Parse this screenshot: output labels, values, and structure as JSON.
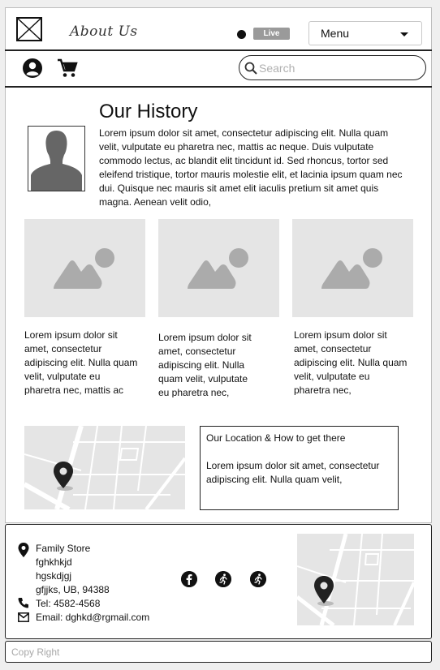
{
  "header": {
    "brand": "About Us",
    "live_label": "Live",
    "menu_label": "Menu"
  },
  "toolbar": {
    "search_placeholder": "Search"
  },
  "history": {
    "title": "Our History",
    "body": "Lorem ipsum dolor sit amet, consectetur adipiscing elit. Nulla quam velit, vulputate eu pharetra nec, mattis ac neque. Duis vulputate commodo lectus, ac blandit elit tincidunt id. Sed rhoncus, tortor sed eleifend tristique, tortor mauris molestie elit, et lacinia ipsum quam nec dui. Quisque nec mauris sit amet elit iaculis pretium sit amet quis magna. Aenean velit odio,"
  },
  "cards": [
    {
      "text": "Lorem ipsum dolor sit amet, consectetur adipiscing elit. Nulla quam velit, vulputate eu pharetra nec, mattis ac"
    },
    {
      "text": "Lorem ipsum dolor sit amet, consectetur adipiscing elit. Nulla quam velit, vulputate eu pharetra nec,"
    },
    {
      "text": "Lorem ipsum dolor sit amet, consectetur adipiscing elit. Nulla quam velit, vulputate eu pharetra nec,"
    }
  ],
  "location": {
    "heading": "Our Location & How to get there",
    "body": "Lorem ipsum dolor sit amet, consectetur adipiscing elit. Nulla quam velit,"
  },
  "footer": {
    "store_name": "Family Store",
    "address_line1": "fghkhkjd",
    "address_line2": "hgskdjgj",
    "address_line3": "gfjjks, UB, 94388",
    "phone": "Tel: 4582-4568",
    "email": "Email: dghkd@rgmail.com",
    "social_icons": [
      "facebook-icon",
      "runner-icon",
      "runner-icon"
    ]
  },
  "copyright": "Copy Right",
  "colors": {
    "placeholder_fill": "#e5e5e5",
    "placeholder_shape": "#ababab",
    "live_badge": "#9a9a9a",
    "ink": "#111111"
  }
}
